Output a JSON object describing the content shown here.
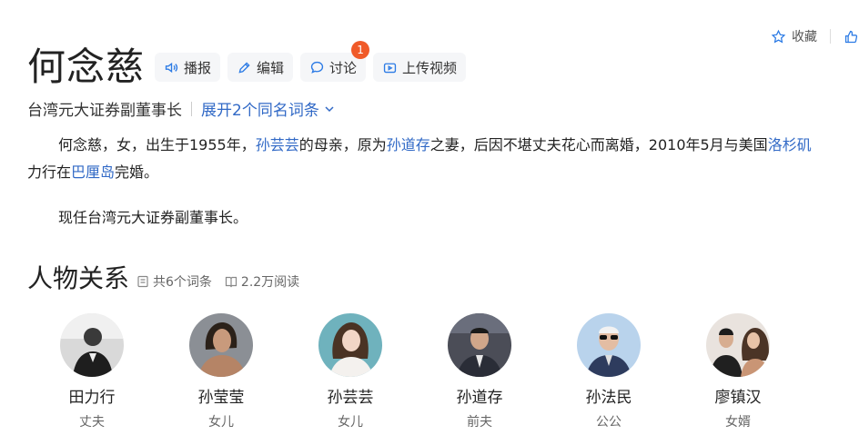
{
  "title": "何念慈",
  "actions": [
    {
      "label": "播报",
      "icon": "speaker-icon"
    },
    {
      "label": "编辑",
      "icon": "pencil-icon"
    },
    {
      "label": "讨论",
      "icon": "chat-icon",
      "badge": "1"
    },
    {
      "label": "上传视频",
      "icon": "video-icon"
    }
  ],
  "topright": {
    "collect_label": "收藏"
  },
  "subtitle": {
    "desc": "台湾元大证券副董事长",
    "expand": "展开2个同名词条"
  },
  "intro": {
    "p1_a": "何念慈，女，出生于1955年，",
    "link1": "孙芸芸",
    "p1_b": "的母亲，原为",
    "link2": "孙道存",
    "p1_c": "之妻，后因不堪丈夫花心而离婚，2010年5月与美国",
    "link3": "洛杉矶",
    "p2_a": "力行在",
    "link4": "巴厘岛",
    "p2_b": "完婚。",
    "p3": "现任台湾元大证券副董事长。"
  },
  "relations": {
    "title": "人物关系",
    "entries_count": "共6个词条",
    "reads": "2.2万阅读",
    "people": [
      {
        "name": "田力行",
        "relation": "丈夫"
      },
      {
        "name": "孙莹莹",
        "relation": "女儿"
      },
      {
        "name": "孙芸芸",
        "relation": "女儿"
      },
      {
        "name": "孙道存",
        "relation": "前夫"
      },
      {
        "name": "孙法民",
        "relation": "公公"
      },
      {
        "name": "廖镇汉",
        "relation": "女婿"
      }
    ]
  },
  "colors": {
    "link": "#3169c6",
    "badge": "#f05a28",
    "icon": "#2c7be5"
  }
}
